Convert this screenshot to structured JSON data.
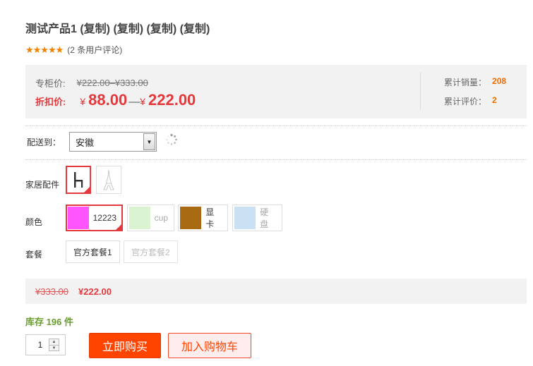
{
  "product": {
    "title": "测试产品1 (复制) (复制) (复制) (复制)",
    "stars": "★★★★★",
    "review_count_text": "(2 条用户评论)"
  },
  "price": {
    "counter_label": "专柜价:",
    "counter_value": "¥222.00–¥333.00",
    "discount_label": "折扣价:",
    "yen_symbol": "¥",
    "discount_low": "88.00",
    "range_dash": "—",
    "discount_high": "222.00"
  },
  "stats": {
    "sales_label": "累计销量：",
    "sales_value": "208",
    "reviews_label": "累计评价：",
    "reviews_value": "2"
  },
  "delivery": {
    "label": "配送到：",
    "selected_region": "安徽"
  },
  "attributes": {
    "furniture": {
      "label": "家居配件",
      "options": [
        {
          "icon": "chair-icon",
          "selected": true
        },
        {
          "icon": "tower-icon",
          "selected": false
        }
      ]
    },
    "color": {
      "label": "颜色",
      "options": [
        {
          "text": "12223",
          "color": "#ff55ff",
          "selected": true
        },
        {
          "text": "cup",
          "color": "#d9f2cf",
          "selected": false
        },
        {
          "text": "显卡",
          "color": "#a86a12",
          "selected": false
        },
        {
          "text": "硬盘",
          "color": "#c9e1f2",
          "selected": false
        }
      ]
    },
    "package": {
      "label": "套餐",
      "options": [
        {
          "text": "官方套餐1",
          "available": true
        },
        {
          "text": "官方套餐2",
          "available": false
        }
      ]
    }
  },
  "summary": {
    "original_price": "¥333.00",
    "current_price": "¥222.00"
  },
  "stock": {
    "text": "库存 196 件"
  },
  "quantity": {
    "value": "1"
  },
  "actions": {
    "buy_now": "立即购买",
    "add_to_cart": "加入购物车"
  },
  "colors": {
    "accent": "#e4393c",
    "buy_button": "#ff4400",
    "stat_value": "#f06c00",
    "stock_green": "#6a9c2f"
  }
}
